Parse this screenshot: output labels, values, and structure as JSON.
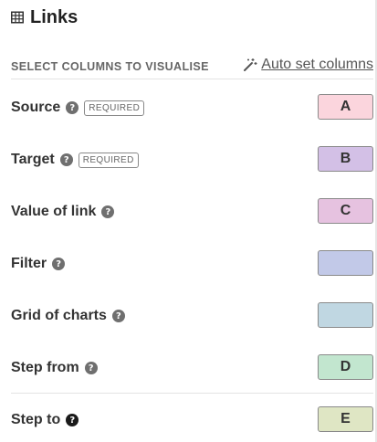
{
  "header": {
    "icon": "table-icon",
    "title": "Links"
  },
  "section": {
    "label": "SELECT COLUMNS TO VISUALISE",
    "auto_set": {
      "icon": "magic-wand-icon",
      "label": "Auto set columns"
    }
  },
  "rows": [
    {
      "label": "Source",
      "required": "REQUIRED",
      "value": "A",
      "color": "#fbd5dd"
    },
    {
      "label": "Target",
      "required": "REQUIRED",
      "value": "B",
      "color": "#d3c0e6"
    },
    {
      "label": "Value of link",
      "value": "C",
      "color": "#e6c2e0"
    },
    {
      "label": "Filter",
      "value": "",
      "color": "#c2c9e8"
    },
    {
      "label": "Grid of charts",
      "value": "",
      "color": "#c0d7e2"
    },
    {
      "label": "Step from",
      "value": "D",
      "color": "#c2e6cf"
    },
    {
      "label": "Step to",
      "value": "E",
      "color": "#dfe6c4"
    }
  ],
  "icons": {
    "help": "question-circle-icon"
  }
}
